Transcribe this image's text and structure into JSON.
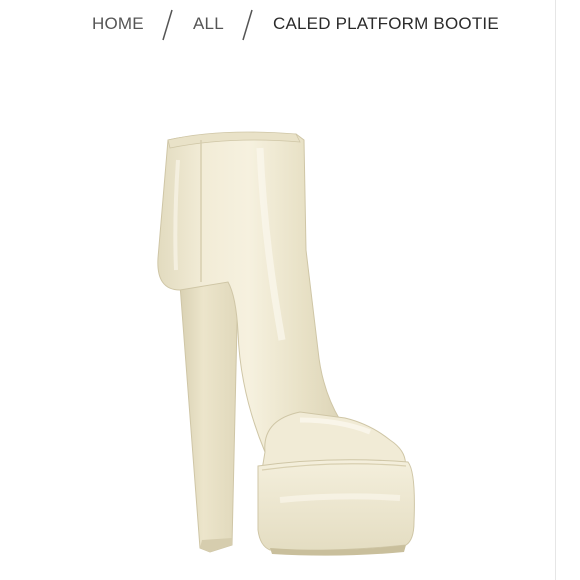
{
  "breadcrumb": {
    "home": "HOME",
    "all": "ALL",
    "current": "CALED PLATFORM BOOTIE"
  },
  "product": {
    "color": "#EDE6CC"
  },
  "icons": {
    "separator": "slash-separator-icon"
  }
}
